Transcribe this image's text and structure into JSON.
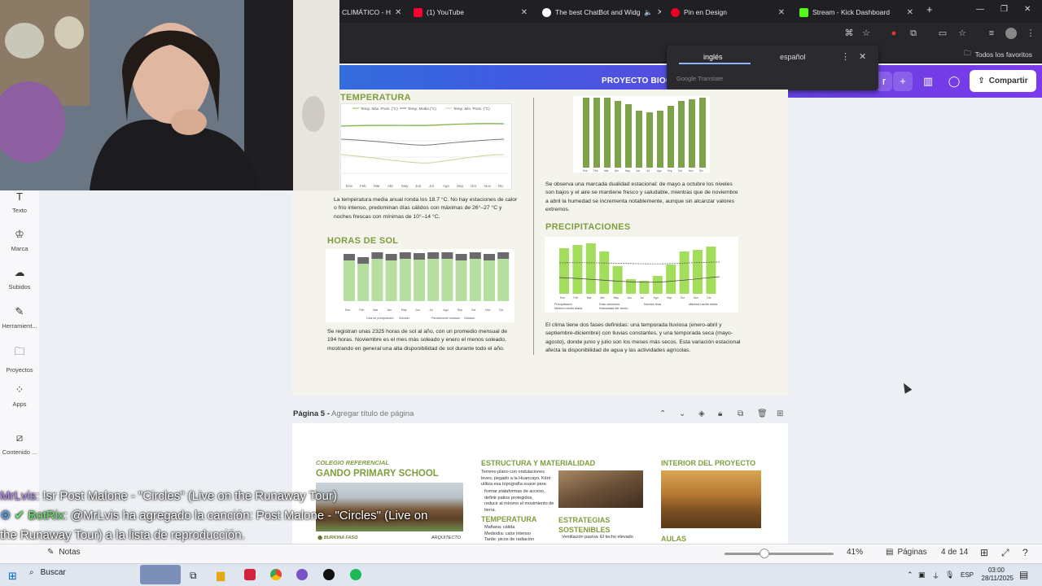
{
  "browser": {
    "tabs": [
      {
        "label": "CLIMÁTICO - H",
        "favicon_color": "#8a8a8a"
      },
      {
        "label": "(1) YouTube",
        "favicon_color": "#ff0033"
      },
      {
        "label": "The best ChatBot and Widg",
        "favicon_color": "#ffffff"
      },
      {
        "label": "Pin en Design",
        "favicon_color": "#e60023"
      },
      {
        "label": "Stream - Kick Dashboard",
        "favicon_color": "#53fc18"
      }
    ],
    "bookmarks_label": "Todos los favoritos"
  },
  "translate_popup": {
    "source_lang": "inglés",
    "target_lang": "español",
    "brand": "Google Translate"
  },
  "canva_header": {
    "project_title": "PROYECTO BIOCL",
    "share_label": "Compartir",
    "brand_colors": [
      "#1d8fd1",
      "#3b5fe0",
      "#7c3aed"
    ]
  },
  "sidebar": {
    "items": [
      {
        "label": "Texto",
        "icon": "text-icon"
      },
      {
        "label": "Marca",
        "icon": "brand-icon"
      },
      {
        "label": "Subidos",
        "icon": "upload-icon"
      },
      {
        "label": "Herramient...",
        "icon": "tools-icon"
      },
      {
        "label": "Proyectos",
        "icon": "folder-icon"
      },
      {
        "label": "Apps",
        "icon": "apps-icon"
      },
      {
        "label": "Contenido ...",
        "icon": "content-icon"
      }
    ]
  },
  "page4": {
    "temp_heading": "TEMPERATURA",
    "temp_legend": [
      "Temp. Máx. Prom. (°C)",
      "Temp. Media (°C)",
      "Temp. Mín. Prom. (°C)"
    ],
    "months": [
      "Ene",
      "Feb",
      "Mar",
      "Abr",
      "May",
      "Jun",
      "Jul",
      "Ago",
      "Sep",
      "Oct",
      "Nov",
      "Dic"
    ],
    "temp_text": "La temperatura media anual ronda los 18.7 °C. No hay estaciones de calor o frío intenso, predominan días cálidos con máximas de 26°–27 °C y noches frescas con mínimas de 10°–14 °C.",
    "sun_heading": "HORAS DE SOL",
    "sun_legend": [
      "Días de precipitación",
      "Soleado",
      "Parcialmente nublado",
      "Nublado"
    ],
    "sun_text": "Se registran unas 2325 horas de sol al año, con un promedio mensual de 194 horas. Noviembre es el mes más soleado y enero el menos soleado, mostrando en general una alta disponibilidad de sol durante todo el año.",
    "humidity_text": "Se observa una marcada dualidad estacional: de mayo a octubre los niveles son bajos y el aire se mantiene fresco y saludable, mientras que de noviembre a abril la humedad se incrementa notablemente, aunque sin alcanzar valores extremos.",
    "precip_heading": "PRECIPITACIONES",
    "precip_legend": [
      "Precipitación",
      "Días calurosos",
      "Noches frías",
      "Máxima media diaria",
      "Mínima media diaria",
      "Nubosidad del viento"
    ],
    "precip_text": "El clima tiene dos fases definidas: una temporada lluviosa (enero-abril y septiembre-diciembre) con lluvias constantes, y una temporada seca (mayo-agosto), donde junio y julio son los meses más secos. Esta variación estacional afecta la disponibilidad de agua y las actividades agrícolas.",
    "accent_color": "#7f9d3d"
  },
  "page5": {
    "label_prefix": "Página 5 -",
    "label_placeholder": "Agregar título de página",
    "col1_kicker": "COLEGIO REFERENCIAL",
    "col1_title": "GANDO PRIMARY SCHOOL",
    "col1_location": "BURKINA FASO",
    "col1_credit": "ARQUITECTO",
    "col2_heading": "ESTRUCTURA Y MATERIALIDAD",
    "col2_text": "Terreno plano con ondulaciones leves, pegado a la Huancayo. Kéré utiliza esa topografía suave para:",
    "col2_bullets": [
      "formar plataformas de acceso,",
      "definir patios protegidos,",
      "reducir al mínimo el movimiento de tierra."
    ],
    "col2_temp_heading": "TEMPERATURA",
    "col2_temp_bullets": [
      "Mañana: cálida",
      "Mediodía: calor intenso",
      "Tarde: picos de radiación"
    ],
    "col2_strat_heading": "ESTRATEGIAS SOSTENIBLES",
    "col2_strat_text": "Ventilación pasiva: El techo elevado",
    "col3_heading": "INTERIOR DEL PROYECTO",
    "col3_sub": "AULAS"
  },
  "chat": [
    {
      "user": "MrLvis",
      "message": ": !sr Post Malone - \"Circles\" (Live on the Runaway Tour)"
    },
    {
      "user": "BotRix",
      "message": ": @MrLvis ha agregado la canción: Post Malone - \"Circles\" (Live on the Runaway Tour) a la lista de reproducción."
    }
  ],
  "bottombar": {
    "notes_label": "Notas",
    "zoom": "41%",
    "zoom_fraction": 0.41,
    "pages_label": "Páginas",
    "page_count": "4 de 14"
  },
  "taskbar": {
    "search_label": "Buscar",
    "lang": "ESP",
    "time": "03:00",
    "date": "28/11/2025"
  }
}
